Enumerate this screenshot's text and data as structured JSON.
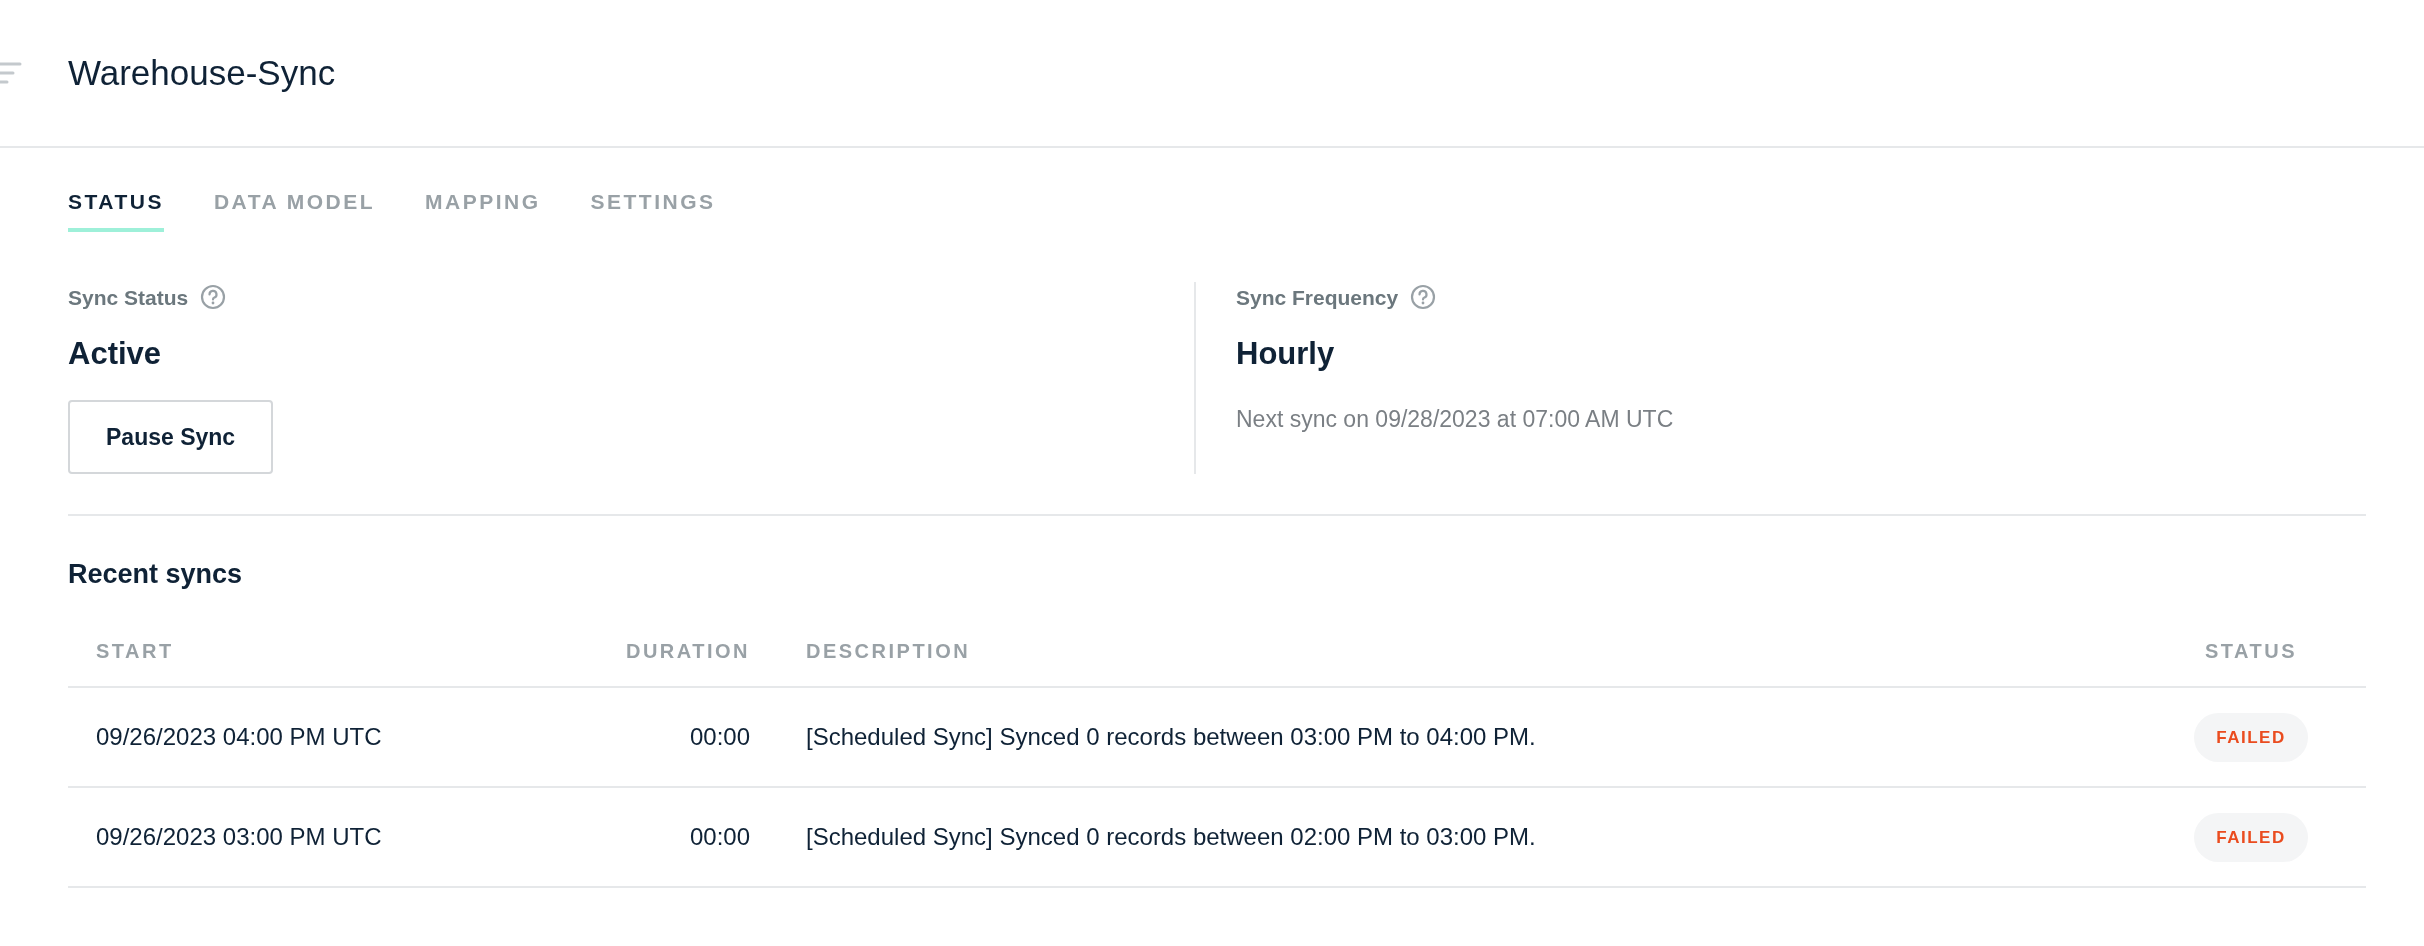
{
  "header": {
    "title": "Warehouse-Sync"
  },
  "tabs": [
    {
      "label": "STATUS",
      "selected": true
    },
    {
      "label": "DATA MODEL",
      "selected": false
    },
    {
      "label": "MAPPING",
      "selected": false
    },
    {
      "label": "SETTINGS",
      "selected": false
    }
  ],
  "sync_status": {
    "label": "Sync Status",
    "value": "Active",
    "button": "Pause Sync"
  },
  "sync_frequency": {
    "label": "Sync Frequency",
    "value": "Hourly",
    "next_sync": "Next sync on 09/28/2023 at 07:00 AM UTC"
  },
  "recent_syncs": {
    "title": "Recent syncs",
    "columns": [
      "START",
      "DURATION",
      "DESCRIPTION",
      "STATUS"
    ],
    "rows": [
      {
        "start": "09/26/2023 04:00 PM UTC",
        "duration": "00:00",
        "description": "[Scheduled Sync] Synced 0 records between 03:00 PM to 04:00 PM.",
        "status": "FAILED",
        "kind": "failed"
      },
      {
        "start": "09/26/2023 03:00 PM UTC",
        "duration": "00:00",
        "description": "[Scheduled Sync] Synced 0 records between 02:00 PM to 03:00 PM.",
        "status": "FAILED",
        "kind": "failed"
      }
    ]
  }
}
